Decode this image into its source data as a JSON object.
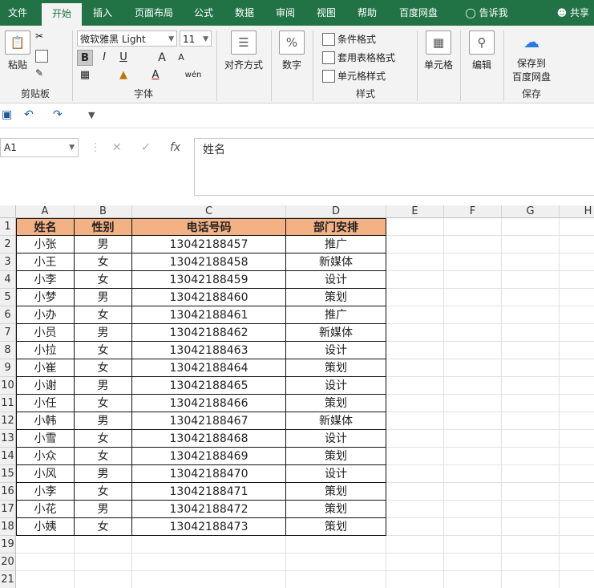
{
  "menu": {
    "tabs": [
      "文件",
      "开始",
      "插入",
      "页面布局",
      "公式",
      "数据",
      "审阅",
      "视图",
      "帮助",
      "百度网盘"
    ],
    "active_tab": "开始",
    "tell_me": "告诉我",
    "share": "共享"
  },
  "ribbon": {
    "clipboard": {
      "paste": "粘贴",
      "label": "剪贴板"
    },
    "font": {
      "name": "微软雅黑 Light",
      "size": "11",
      "bold": "B",
      "italic": "I",
      "underline": "U",
      "grow": "A",
      "shrink": "A",
      "wen": "wén",
      "label": "字体"
    },
    "align": {
      "label": "对齐方式"
    },
    "number": {
      "icon_text": "%",
      "label": "数字"
    },
    "styles": {
      "conditional": "条件格式",
      "table_format": "套用表格格式",
      "cell_style": "单元格样式",
      "label": "样式"
    },
    "cells": {
      "label": "单元格"
    },
    "edit": {
      "label": "编辑"
    },
    "save": {
      "label_line1": "保存到",
      "label_line2": "百度网盘",
      "group": "保存"
    }
  },
  "formula_bar": {
    "name_box": "A1",
    "fx": "fx",
    "content": "姓名"
  },
  "sheet": {
    "columns": [
      "A",
      "B",
      "C",
      "D",
      "E",
      "F",
      "G",
      "H"
    ],
    "header": [
      "姓名",
      "性别",
      "电话号码",
      "部门安排"
    ],
    "rows": [
      [
        "小张",
        "男",
        "13042188457",
        "推广"
      ],
      [
        "小王",
        "女",
        "13042188458",
        "新媒体"
      ],
      [
        "小李",
        "女",
        "13042188459",
        "设计"
      ],
      [
        "小梦",
        "男",
        "13042188460",
        "策划"
      ],
      [
        "小办",
        "女",
        "13042188461",
        "推广"
      ],
      [
        "小员",
        "男",
        "13042188462",
        "新媒体"
      ],
      [
        "小拉",
        "女",
        "13042188463",
        "设计"
      ],
      [
        "小崔",
        "女",
        "13042188464",
        "策划"
      ],
      [
        "小谢",
        "男",
        "13042188465",
        "设计"
      ],
      [
        "小任",
        "女",
        "13042188466",
        "策划"
      ],
      [
        "小韩",
        "男",
        "13042188467",
        "新媒体"
      ],
      [
        "小雪",
        "女",
        "13042188468",
        "设计"
      ],
      [
        "小众",
        "女",
        "13042188469",
        "策划"
      ],
      [
        "小风",
        "男",
        "13042188470",
        "设计"
      ],
      [
        "小李",
        "女",
        "13042188471",
        "策划"
      ],
      [
        "小花",
        "男",
        "13042188472",
        "策划"
      ],
      [
        "小姨",
        "女",
        "13042188473",
        "策划"
      ]
    ],
    "row_numbers": [
      "1",
      "2",
      "3",
      "4",
      "5",
      "6",
      "7",
      "8",
      "9",
      "10",
      "11",
      "12",
      "13",
      "14",
      "15",
      "16",
      "17",
      "18",
      "19",
      "20",
      "21"
    ],
    "header_fill": "#f4b183"
  },
  "colors": {
    "brand": "#217346"
  }
}
